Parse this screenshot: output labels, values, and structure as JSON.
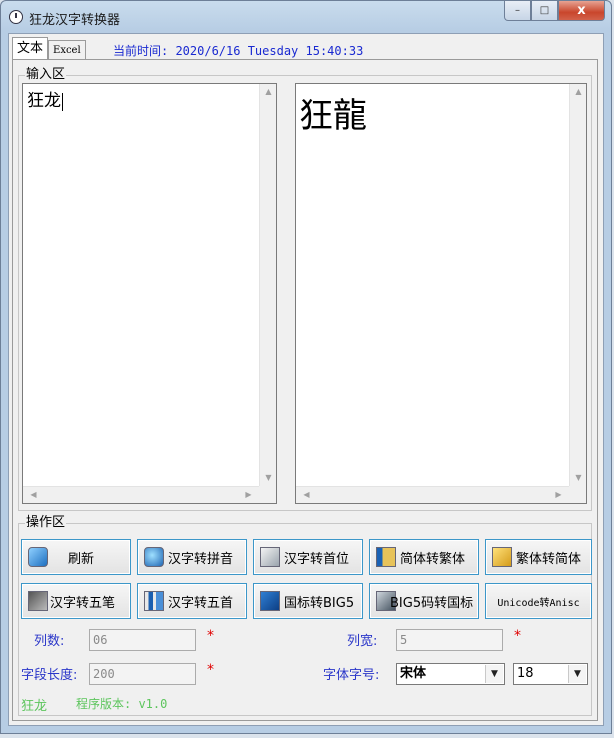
{
  "window": {
    "title": "狂龙汉字转换器",
    "caption_min": "–",
    "caption_max": "□",
    "caption_close": "x"
  },
  "tabs": [
    {
      "label": "文本"
    },
    {
      "label": "Excel"
    }
  ],
  "time_label": "当前时间: 2020/6/16 Tuesday  15:40:33",
  "input_group": {
    "title": "输入区"
  },
  "input_text": "狂龙",
  "output_text": "狂龍",
  "ops_group": {
    "title": "操作区"
  },
  "buttons": [
    {
      "label": "刷新"
    },
    {
      "label": "汉字转拼音"
    },
    {
      "label": "汉字转首位"
    },
    {
      "label": "简体转繁体"
    },
    {
      "label": "繁体转简体"
    },
    {
      "label": "汉字转五笔"
    },
    {
      "label": "汉字转五首"
    },
    {
      "label": "国标转BIG5"
    },
    {
      "label": "BIG5码转国标"
    },
    {
      "label": "Unicode转Anisc"
    }
  ],
  "fields": {
    "col_count": {
      "label": "列数:",
      "value": "06"
    },
    "col_width": {
      "label": "列宽:",
      "value": "5"
    },
    "field_length": {
      "label": "字段长度:",
      "value": "200"
    },
    "font_size_label": "字体字号:",
    "font_name": "宋体",
    "font_size": "18",
    "required_mark": "*"
  },
  "footer": {
    "author": "狂龙",
    "version": "程序版本: v1.0"
  },
  "scroll": {
    "up": "▲",
    "down": "▼",
    "left": "◀",
    "right": "▶"
  },
  "colors": {
    "accent_label": "#2a36c9",
    "button_border": "#3c97c9",
    "required": "#e00000",
    "footer": "#5dc55d"
  }
}
